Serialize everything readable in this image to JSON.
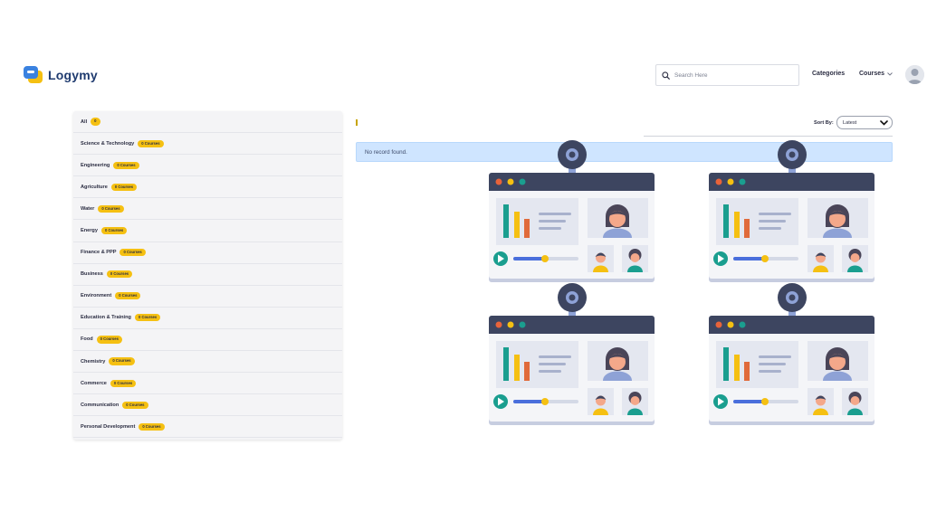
{
  "header": {
    "logo_text": "Logymy",
    "search_placeholder": "Search Here",
    "nav": {
      "categories": "Categories",
      "courses": "Courses"
    }
  },
  "sidebar": {
    "items": [
      {
        "label": "All",
        "badge": "0"
      },
      {
        "label": "Science & Technology",
        "badge": "0 Courses"
      },
      {
        "label": "Engineering",
        "badge": "0 Courses"
      },
      {
        "label": "Agriculture",
        "badge": "0 Courses"
      },
      {
        "label": "Water",
        "badge": "0 Courses"
      },
      {
        "label": "Energy",
        "badge": "0 Courses"
      },
      {
        "label": "Finance & PPP",
        "badge": "0 Courses"
      },
      {
        "label": "Business",
        "badge": "0 Courses"
      },
      {
        "label": "Environment",
        "badge": "0 Courses"
      },
      {
        "label": "Education & Training",
        "badge": "0 Courses"
      },
      {
        "label": "Food",
        "badge": "0 Courses"
      },
      {
        "label": "Chemistry",
        "badge": "0 Courses"
      },
      {
        "label": "Commerce",
        "badge": "0 Courses"
      },
      {
        "label": "Communication",
        "badge": "0 Courses"
      },
      {
        "label": "Personal Development",
        "badge": "0 Courses"
      }
    ]
  },
  "main": {
    "sort_label": "Sort By:",
    "sort_value": "Latest",
    "empty_message": "No record found."
  },
  "colors": {
    "accent_yellow": "#f5c012",
    "alert_bg": "#cfe5ff",
    "window_bar": "#3d4560",
    "bar_teal": "#1a9e8f",
    "bar_orange": "#e06a3b",
    "progress_blue": "#4a6fdc"
  }
}
